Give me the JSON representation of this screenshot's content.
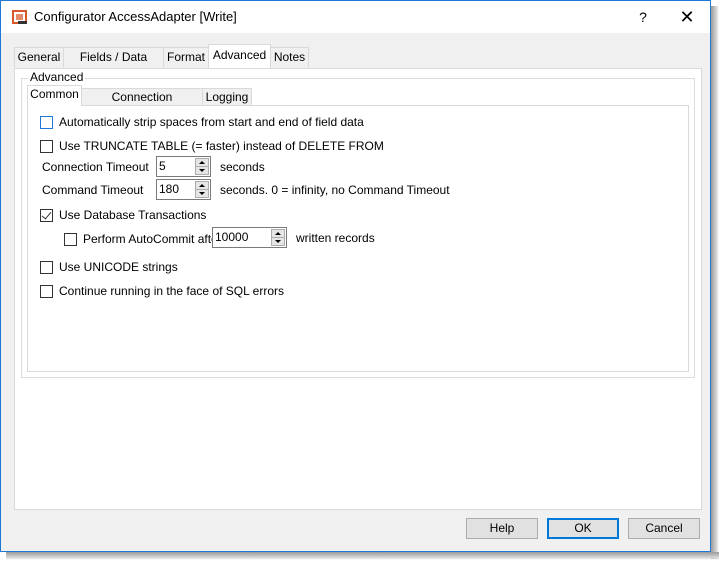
{
  "window": {
    "title": "Configurator AccessAdapter [Write]",
    "help_button": "?",
    "close_button": "✕",
    "app_icon": "configurator-app-icon"
  },
  "tabs": [
    {
      "label": "General",
      "selected": false
    },
    {
      "label": "Fields / Data types",
      "selected": false
    },
    {
      "label": "Format",
      "selected": false
    },
    {
      "label": "Advanced",
      "selected": true
    },
    {
      "label": "Notes",
      "selected": false
    }
  ],
  "advanced": {
    "group_label": "Advanced",
    "subtabs": [
      {
        "label": "Common",
        "selected": true
      },
      {
        "label": "Connection initialization",
        "selected": false
      },
      {
        "label": "Logging",
        "selected": false
      }
    ],
    "common": {
      "strip_spaces": {
        "label": "Automatically strip spaces from start and end of field data",
        "checked": false
      },
      "truncate_table": {
        "label": "Use TRUNCATE TABLE (= faster) instead of DELETE FROM",
        "checked": false
      },
      "connection_timeout": {
        "label": "Connection Timeout",
        "value": "5",
        "unit": "seconds"
      },
      "command_timeout": {
        "label": "Command Timeout",
        "value": "180",
        "unit": "seconds. 0 = infinity, no Command Timeout"
      },
      "use_transactions": {
        "label": "Use Database Transactions",
        "checked": true
      },
      "autocommit": {
        "label": "Perform AutoCommit after",
        "checked": false,
        "value": "10000",
        "unit": "written records"
      },
      "unicode": {
        "label": "Use UNICODE strings",
        "checked": false
      },
      "continue_on_error": {
        "label": "Continue running in the face of SQL errors",
        "checked": false
      }
    }
  },
  "buttons": {
    "help": "Help",
    "ok": "OK",
    "cancel": "Cancel"
  },
  "colors": {
    "accent": "#0078d7",
    "window_border": "#1c7ad4",
    "icon": "#d9572b"
  }
}
